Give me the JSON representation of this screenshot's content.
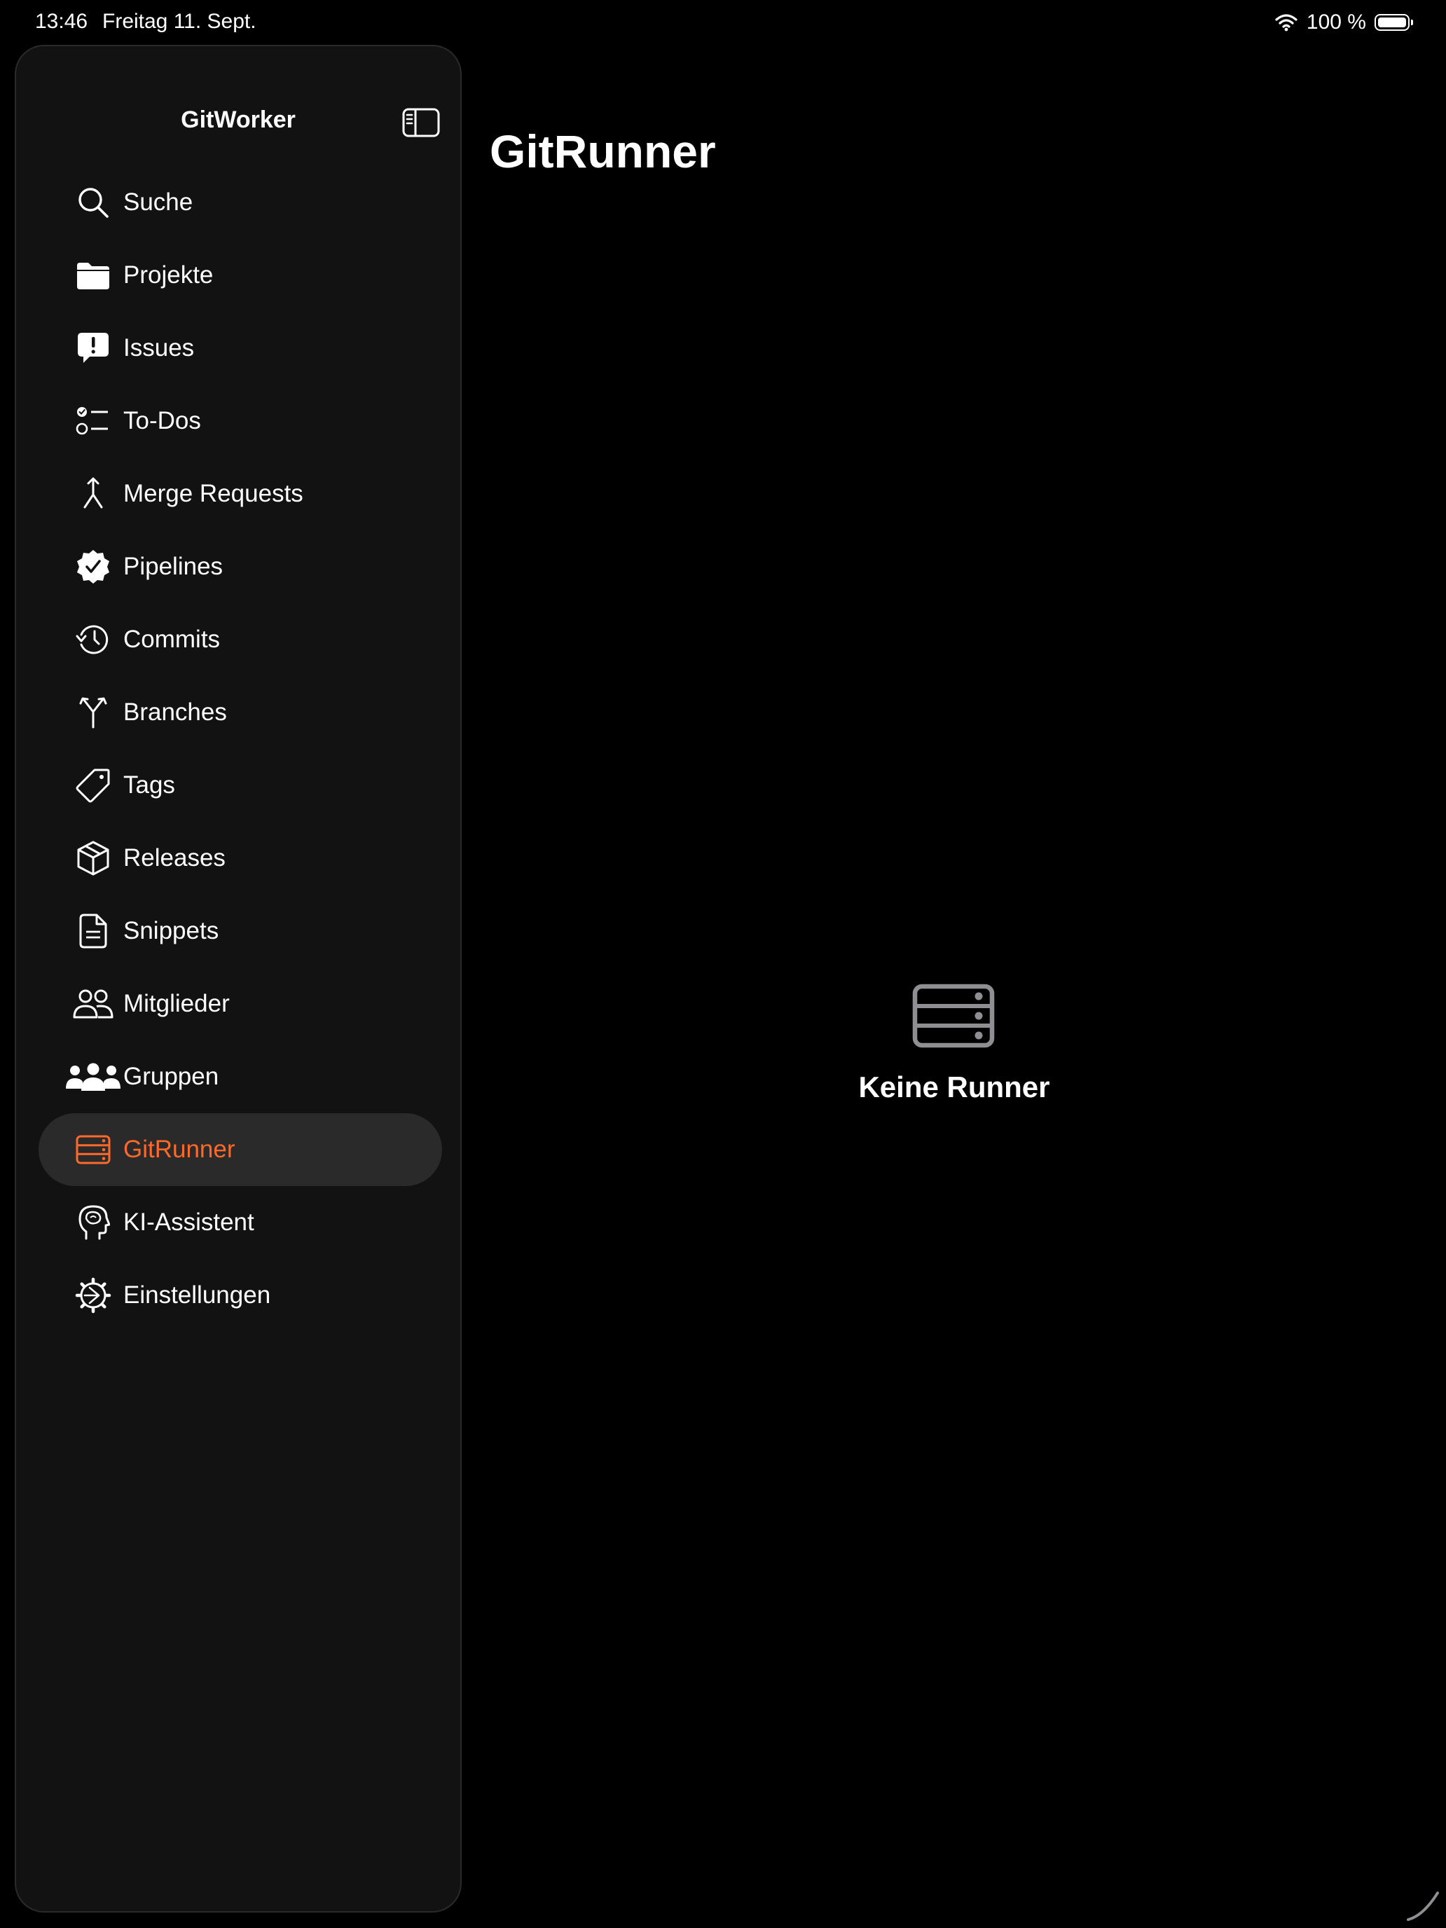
{
  "status_bar": {
    "time": "13:46",
    "date": "Freitag 11. Sept.",
    "battery_percent": "100 %",
    "battery_level": 1.0
  },
  "sidebar": {
    "title": "GitWorker",
    "toggle_icon": "sidebar-left-icon",
    "items": [
      {
        "label": "Suche",
        "icon": "search-icon",
        "active": false
      },
      {
        "label": "Projekte",
        "icon": "folder-icon",
        "active": false
      },
      {
        "label": "Issues",
        "icon": "exclamation-bubble-icon",
        "active": false
      },
      {
        "label": "To-Dos",
        "icon": "checklist-icon",
        "active": false
      },
      {
        "label": "Merge Requests",
        "icon": "merge-icon",
        "active": false
      },
      {
        "label": "Pipelines",
        "icon": "checkmark-seal-icon",
        "active": false
      },
      {
        "label": "Commits",
        "icon": "history-clock-icon",
        "active": false
      },
      {
        "label": "Branches",
        "icon": "branch-icon",
        "active": false
      },
      {
        "label": "Tags",
        "icon": "tag-icon",
        "active": false
      },
      {
        "label": "Releases",
        "icon": "package-box-icon",
        "active": false
      },
      {
        "label": "Snippets",
        "icon": "document-icon",
        "active": false
      },
      {
        "label": "Mitglieder",
        "icon": "two-people-icon",
        "active": false
      },
      {
        "label": "Gruppen",
        "icon": "three-people-icon",
        "active": false
      },
      {
        "label": "GitRunner",
        "icon": "server-rack-icon",
        "active": true
      },
      {
        "label": "KI-Assistent",
        "icon": "brain-head-icon",
        "active": false
      },
      {
        "label": "Einstellungen",
        "icon": "gear-icon",
        "active": false
      }
    ]
  },
  "main": {
    "title": "GitRunner",
    "empty_state_icon": "server-rack-icon",
    "empty_state_text": "Keine Runner"
  },
  "colors": {
    "accent": "#ff6a2b",
    "background": "#000000",
    "sidebar_background": "#121212",
    "selection": "#2a2a2a",
    "empty_icon": "#8e8e93"
  }
}
